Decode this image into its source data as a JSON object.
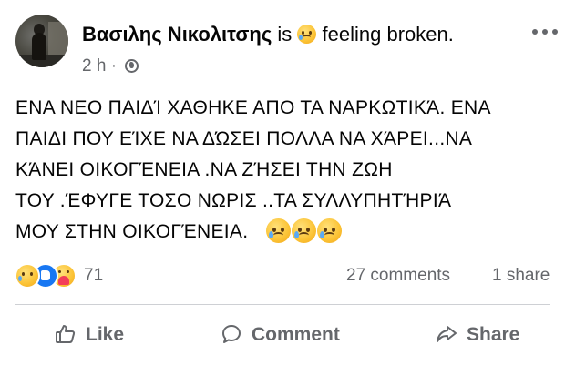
{
  "post": {
    "author": "Βασιλης Νικολιτσης",
    "feeling_prefix": "is",
    "feeling_icon": "sad-face-icon",
    "feeling": "feeling broken.",
    "time": "2 h ·",
    "privacy_icon": "globe-icon",
    "more_icon": "more-options-icon",
    "body_lines": [
      "ΕΝΑ ΝΕΟ ΠΑΙΔΊ ΧΑΘΗΚΕ ΑΠΟ ΤΑ ΝΑΡΚΩΤΙΚΆ. ΕΝΑ",
      "ΠΑΙΔΙ ΠΟΥ ΕΊΧΕ ΝΑ ΔΏΣΕΙ ΠΟΛΛΑ ΝΑ ΧΆΡΕΙ...ΝΑ",
      "ΚΆΝΕΙ ΟΙΚΟΓΈΝΕΙΑ .ΝΑ ΖΉΣΕΙ ΤΗΝ ΖΩΗ",
      "ΤΟΥ .ΈΦΥΓΕ ΤΟΣΟ ΝΩΡΙΣ ..ΤΑ ΣΥΛΛΥΠΗΤΉΡΙΆ",
      "ΜΟΥ ΣΤΗΝ ΟΙΚΟΓΈΝΕΙΑ."
    ],
    "body_emoji_icon": "sad-tear-face-icon"
  },
  "stats": {
    "reaction_icons": [
      "sad-reaction-icon",
      "like-reaction-icon",
      "care-reaction-icon"
    ],
    "reactions_count": "71",
    "comments": "27 comments",
    "shares": "1 share"
  },
  "actions": {
    "like_label": "Like",
    "comment_label": "Comment",
    "share_label": "Share"
  },
  "colors": {
    "text": "#050505",
    "secondary": "#65676b",
    "like_blue": "#1877f2",
    "divider": "#ced0d4"
  }
}
